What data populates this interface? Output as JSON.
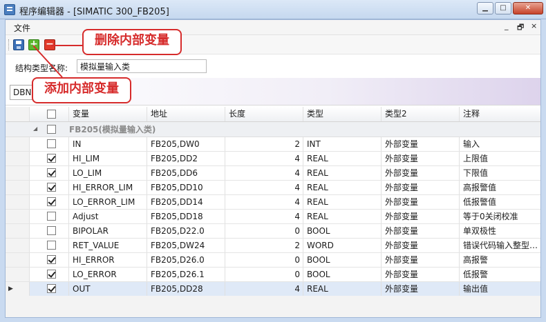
{
  "window": {
    "title": "程序编辑器 - [SIMATIC 300_FB205]",
    "minimize_glyph": "▁",
    "maximize_glyph": "□",
    "close_glyph": "✕"
  },
  "menu": {
    "file": "文件",
    "mdi_min": "_",
    "mdi_restore": "🗗",
    "mdi_close": "×"
  },
  "toolbar": {
    "add_glyph": "+",
    "delete_glyph": "−"
  },
  "name_row": {
    "label": "结构类型名称:",
    "value": "模拟量输入类"
  },
  "tab": {
    "label": "DBNO"
  },
  "columns": [
    "变量",
    "地址",
    "长度",
    "类型",
    "类型2",
    "注释"
  ],
  "group": {
    "expander": "◢",
    "label": "FB205(模拟量输入类)"
  },
  "rows": [
    {
      "checked": false,
      "var": "IN",
      "addr": "FB205,DW0",
      "len": "2",
      "type": "INT",
      "type2": "外部变量",
      "note": "输入"
    },
    {
      "checked": true,
      "var": "HI_LIM",
      "addr": "FB205,DD2",
      "len": "4",
      "type": "REAL",
      "type2": "外部变量",
      "note": "上限值"
    },
    {
      "checked": true,
      "var": "LO_LIM",
      "addr": "FB205,DD6",
      "len": "4",
      "type": "REAL",
      "type2": "外部变量",
      "note": "下限值"
    },
    {
      "checked": true,
      "var": "HI_ERROR_LIM",
      "addr": "FB205,DD10",
      "len": "4",
      "type": "REAL",
      "type2": "外部变量",
      "note": "高报警值"
    },
    {
      "checked": true,
      "var": "LO_ERROR_LIM",
      "addr": "FB205,DD14",
      "len": "4",
      "type": "REAL",
      "type2": "外部变量",
      "note": "低报警值"
    },
    {
      "checked": false,
      "var": "Adjust",
      "addr": "FB205,DD18",
      "len": "4",
      "type": "REAL",
      "type2": "外部变量",
      "note": "等于0关闭校准"
    },
    {
      "checked": false,
      "var": "BIPOLAR",
      "addr": "FB205,D22.0",
      "len": "0",
      "type": "BOOL",
      "type2": "外部变量",
      "note": "单双极性"
    },
    {
      "checked": false,
      "var": "RET_VALUE",
      "addr": "FB205,DW24",
      "len": "2",
      "type": "WORD",
      "type2": "外部变量",
      "note": "错误代码输入整型…"
    },
    {
      "checked": true,
      "var": "HI_ERROR",
      "addr": "FB205,D26.0",
      "len": "0",
      "type": "BOOL",
      "type2": "外部变量",
      "note": "高报警"
    },
    {
      "checked": true,
      "var": "LO_ERROR",
      "addr": "FB205,D26.1",
      "len": "0",
      "type": "BOOL",
      "type2": "外部变量",
      "note": "低报警"
    },
    {
      "checked": true,
      "var": "OUT",
      "addr": "FB205,DD28",
      "len": "4",
      "type": "REAL",
      "type2": "外部变量",
      "note": "输出值",
      "selected": true,
      "arrow": "▶"
    }
  ],
  "callouts": {
    "delete": "删除内部变量",
    "add": "添加内部变量"
  },
  "colors": {
    "accent_red": "#d62b2b",
    "add_green": "#5cb82e",
    "delete_red": "#e23a2a"
  }
}
